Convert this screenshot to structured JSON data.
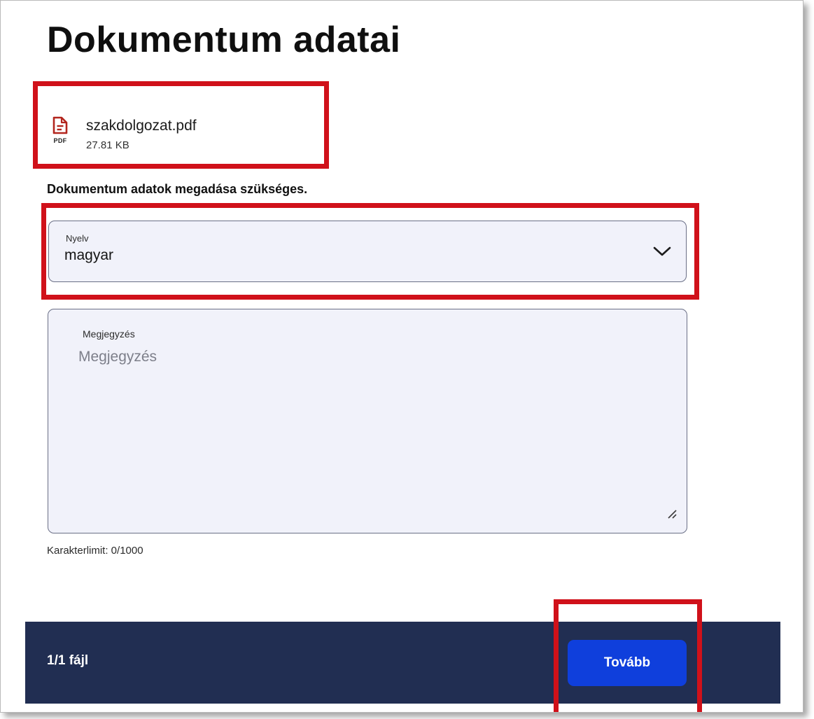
{
  "page": {
    "title": "Dokumentum adatai"
  },
  "file": {
    "name": "szakdolgozat.pdf",
    "size": "27.81 KB",
    "type_tag": "PDF",
    "icon": "pdf-file-icon"
  },
  "form": {
    "required_note": "Dokumentum adatok megadása szükséges.",
    "language": {
      "label": "Nyelv",
      "value": "magyar",
      "icon": "chevron-down-icon"
    },
    "note": {
      "label": "Megjegyzés",
      "placeholder": "Megjegyzés",
      "value": ""
    },
    "char_limit": "Karakterlimit: 0/1000"
  },
  "footer": {
    "file_count": "1/1 fájl",
    "next_label": "Tovább"
  },
  "colors": {
    "highlight": "#d0111a",
    "footer_bg": "#212e52",
    "button_bg": "#0f3fdc",
    "field_bg": "#f1f2fa",
    "pdf_icon": "#b3261e"
  }
}
